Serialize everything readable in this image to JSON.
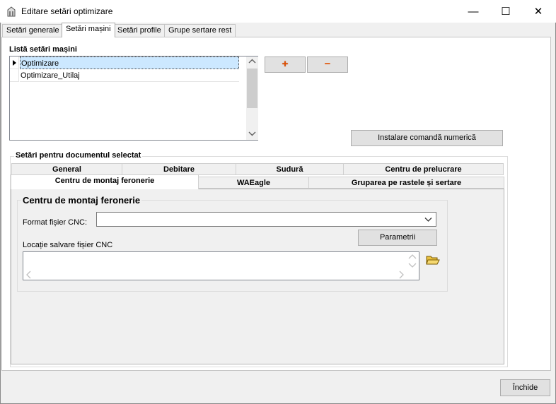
{
  "window": {
    "title": "Editare setări optimizare",
    "minimize": "—",
    "maximize": "☐",
    "close": "✕"
  },
  "tabs": [
    "Setări generale",
    "Setări mașini",
    "Setări profile",
    "Grupe sertare rest"
  ],
  "machines": {
    "label": "Listă setări mașini",
    "items": [
      "Optimizare",
      "Optimizare_Utilaj"
    ],
    "add": "+",
    "remove": "−",
    "install_button": "Instalare comandă numerică"
  },
  "document_settings": {
    "label": "Setări pentru documentul selectat",
    "tabs_row1": [
      "General",
      "Debitare",
      "Sudură",
      "Centru de prelucrare"
    ],
    "tabs_row2": [
      "Centru de montaj feronerie",
      "WAEagle",
      "Gruparea pe rastele și sertare"
    ],
    "panel": {
      "title": "Centru de montaj feronerie",
      "format_label": "Format fișier CNC:",
      "format_value": "",
      "params_button": "Parametrii",
      "location_label": "Locație salvare fișier CNC",
      "location_value": ""
    }
  },
  "close_button": "Închide"
}
